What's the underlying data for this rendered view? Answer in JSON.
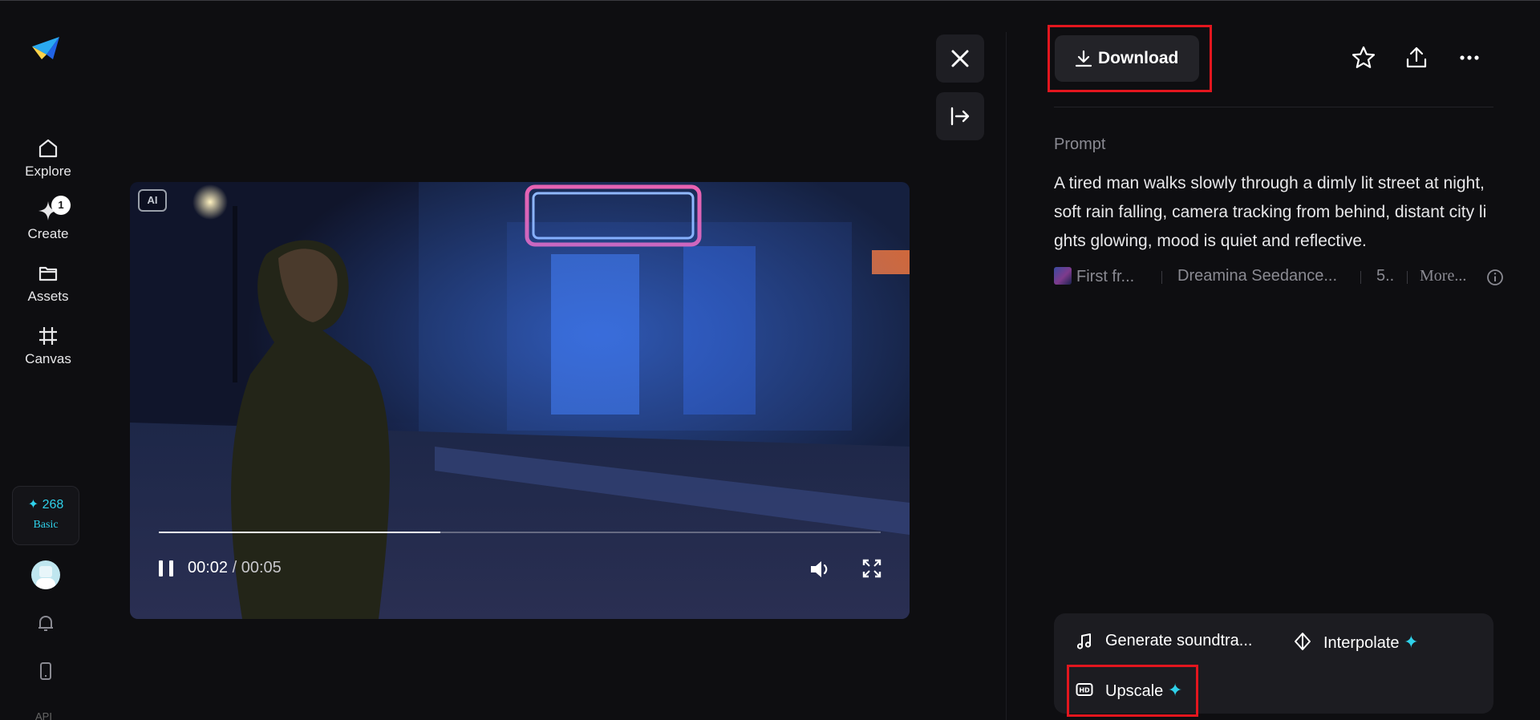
{
  "sidebar": {
    "nav": [
      {
        "label": "Explore",
        "icon": "home-icon"
      },
      {
        "label": "Create",
        "icon": "sparkle-icon",
        "badge": "1"
      },
      {
        "label": "Assets",
        "icon": "folder-icon"
      },
      {
        "label": "Canvas",
        "icon": "canvas-icon"
      }
    ],
    "credits": {
      "amount": "✦ 268",
      "plan": "Basic"
    },
    "api_label": "API"
  },
  "video": {
    "ai_badge": "AI",
    "current_time": "00:02",
    "separator": " / ",
    "duration": "00:05",
    "progress_fraction": 0.39
  },
  "toolbar": {
    "download_label": "Download"
  },
  "details": {
    "prompt_label": "Prompt",
    "prompt_text": "A tired man walks slowly through a dimly lit street at night, soft rain falling, camera tracking from behind, distant city lights glowing, mood is quiet and reflective.",
    "meta": {
      "first_frame": "First fr...",
      "model": "Dreamina Seedance...",
      "duration": "5..",
      "more": "More..."
    }
  },
  "tools": {
    "soundtrack": "Generate soundtra...",
    "interpolate": "Interpolate",
    "upscale": "Upscale",
    "sparkle": "✦"
  },
  "colors": {
    "accent": "#2fd1ea",
    "highlight": "#e3161e",
    "background": "#0e0e11"
  }
}
